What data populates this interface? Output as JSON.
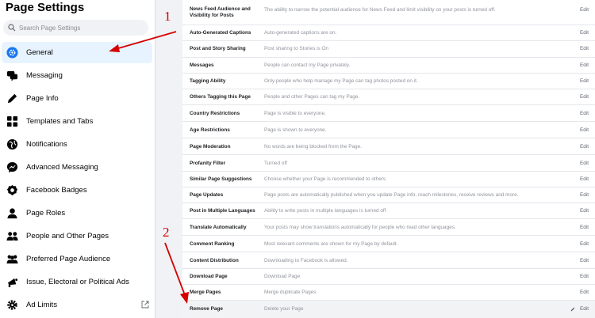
{
  "sidebar": {
    "title": "Page Settings",
    "search_placeholder": "Search Page Settings",
    "items": [
      {
        "label": "General",
        "icon": "gear-icon"
      },
      {
        "label": "Messaging",
        "icon": "chat-icon"
      },
      {
        "label": "Page Info",
        "icon": "pencil-icon"
      },
      {
        "label": "Templates and Tabs",
        "icon": "grid-icon"
      },
      {
        "label": "Notifications",
        "icon": "globe-icon"
      },
      {
        "label": "Advanced Messaging",
        "icon": "messenger-icon"
      },
      {
        "label": "Facebook Badges",
        "icon": "badge-icon"
      },
      {
        "label": "Page Roles",
        "icon": "person-icon"
      },
      {
        "label": "People and Other Pages",
        "icon": "people-icon"
      },
      {
        "label": "Preferred Page Audience",
        "icon": "audience-icon"
      },
      {
        "label": "Issue, Electoral or Political Ads",
        "icon": "megaphone-icon"
      },
      {
        "label": "Ad Limits",
        "icon": "settings-icon"
      }
    ]
  },
  "settings": {
    "edit_label": "Edit",
    "rows": [
      {
        "label": "News Feed Audience and Visibility for Posts",
        "desc": "The ability to narrow the potential audience for News Feed and limit visibility on your posts is turned off."
      },
      {
        "label": "Auto-Generated Captions",
        "desc": "Auto-generated captions are on."
      },
      {
        "label": "Post and Story Sharing",
        "desc": "Post sharing to Stories is On"
      },
      {
        "label": "Messages",
        "desc": "People can contact my Page privately."
      },
      {
        "label": "Tagging Ability",
        "desc": "Only people who help manage my Page can tag photos posted on it."
      },
      {
        "label": "Others Tagging this Page",
        "desc": "People and other Pages can tag my Page."
      },
      {
        "label": "Country Restrictions",
        "desc": "Page is visible to everyone."
      },
      {
        "label": "Age Restrictions",
        "desc": "Page is shown to everyone."
      },
      {
        "label": "Page Moderation",
        "desc": "No words are being blocked from the Page."
      },
      {
        "label": "Profanity Filter",
        "desc": "Turned off"
      },
      {
        "label": "Similar Page Suggestions",
        "desc": "Choose whether your Page is recommended to others"
      },
      {
        "label": "Page Updates",
        "desc": "Page posts are automatically published when you update Page info, reach milestones, receive reviews and more."
      },
      {
        "label": "Post in Multiple Languages",
        "desc": "Ability to write posts in multiple languages is turned off"
      },
      {
        "label": "Translate Automatically",
        "desc": "Your posts may show translations automatically for people who read other languages."
      },
      {
        "label": "Comment Ranking",
        "desc": "Most relevant comments are shown for my Page by default."
      },
      {
        "label": "Content Distribution",
        "desc": "Downloading to Facebook is allowed."
      },
      {
        "label": "Download Page",
        "desc": "Download Page"
      },
      {
        "label": "Merge Pages",
        "desc": "Merge duplicate Pages"
      },
      {
        "label": "Remove Page",
        "desc": "Delete your Page"
      }
    ]
  },
  "annotations": {
    "step1": "1",
    "step2": "2",
    "color": "#d40000"
  }
}
